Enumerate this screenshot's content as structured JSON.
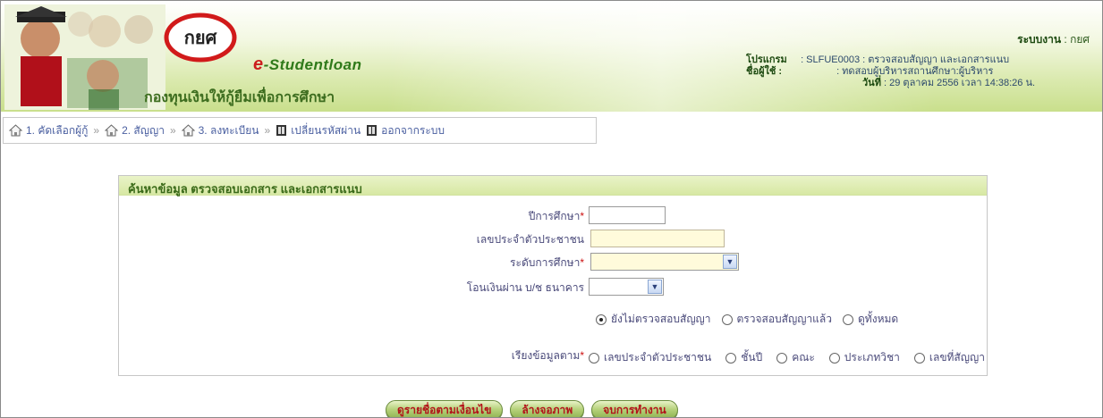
{
  "header": {
    "brand_prefix": "e",
    "brand_name": "-Studentloan",
    "brand_thai": "กองทุนเงินให้กู้ยืมเพื่อการศึกษา",
    "system_label": "ระบบงาน",
    "system_value": ": กยศ",
    "program_label": "โปรแกรม",
    "program_value": ": SLFUE0003 : ตรวจสอบสัญญา และเอกสารแนบ",
    "user_label": "ชื่อผู้ใช้ :",
    "user_value": ": ทดสอบผู้บริหารสถานศึกษา:ผู้บริหาร",
    "date_label": "วันที่",
    "date_value": ": 29 ตุลาคม 2556 เวลา 14:38:26 น."
  },
  "nav": {
    "items": [
      {
        "label": "1. คัดเลือกผู้กู้",
        "icon": "home-icon"
      },
      {
        "label": "2. สัญญา",
        "icon": "home-icon"
      },
      {
        "label": "3. ลงทะเบียน",
        "icon": "home-icon"
      },
      {
        "label": "เปลี่ยนรหัสผ่าน",
        "icon": "door-icon"
      },
      {
        "label": "ออกจากระบบ",
        "icon": "door-icon"
      }
    ],
    "separator": "»"
  },
  "form": {
    "title": "ค้นหาข้อมูล ตรวจสอบเอกสาร และเอกสารแนบ",
    "year_label": "ปีการศึกษา",
    "year_value": "",
    "citizen_label": "เลขประจำตัวประชาชน",
    "citizen_value": "",
    "level_label": "ระดับการศึกษา",
    "level_value": "",
    "bank_label": "โอนเงินผ่าน บ/ช ธนาคาร",
    "bank_value": "",
    "required_mark": "*",
    "status_options": [
      "ยังไม่ตรวจสอบสัญญา",
      "ตรวจสอบสัญญาแล้ว",
      "ดูทั้งหมด"
    ],
    "status_selected": 0,
    "sort_label": "เรียงข้อมูลตาม",
    "sort_options": [
      "เลขประจำตัวประชาชน",
      "ชั้นปี",
      "คณะ",
      "ประเภทวิชา",
      "เลขที่สัญญา"
    ]
  },
  "buttons": {
    "search": "ดูรายชื่อตามเงื่อนไข",
    "clear": "ล้างจอภาพ",
    "exit": "จบการทำงาน"
  },
  "colors": {
    "accent_green": "#3a6a19",
    "button_text": "#b3131a",
    "nav_text": "#4a5fa0"
  }
}
